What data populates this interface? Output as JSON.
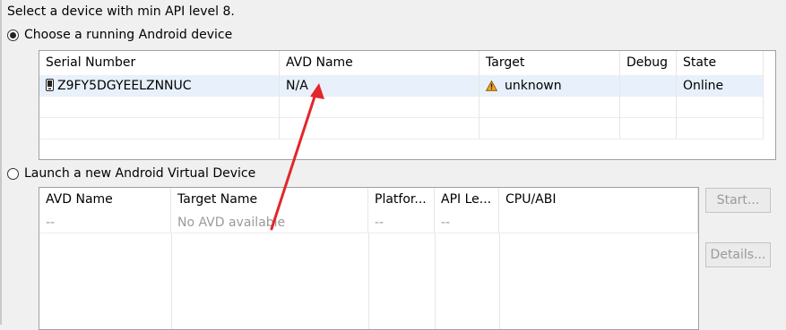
{
  "header": "Select a device with min API level 8.",
  "running": {
    "label": "Choose a running Android device",
    "columns": [
      "Serial Number",
      "AVD Name",
      "Target",
      "Debug",
      "State"
    ],
    "row": {
      "serial": "Z9FY5DGYEELZNNUC",
      "avd": "N/A",
      "target": "unknown",
      "debug": "",
      "state": "Online"
    }
  },
  "launch": {
    "label": "Launch a new Android Virtual Device",
    "columns": [
      "AVD Name",
      "Target Name",
      "Platfor...",
      "API Le...",
      "CPU/ABI"
    ],
    "row": {
      "avd": "--",
      "target": "No AVD available",
      "platform": "--",
      "api": "--",
      "cpu": ""
    },
    "buttons": {
      "start": "Start...",
      "details": "Details..."
    }
  },
  "icons": {
    "device": "phone-icon",
    "warning": "warning-icon",
    "annotation": "red-arrow-annotation"
  },
  "colors": {
    "selected_row": "#e8f1fb",
    "warning": "#f5a623",
    "arrow": "#e2262b"
  }
}
